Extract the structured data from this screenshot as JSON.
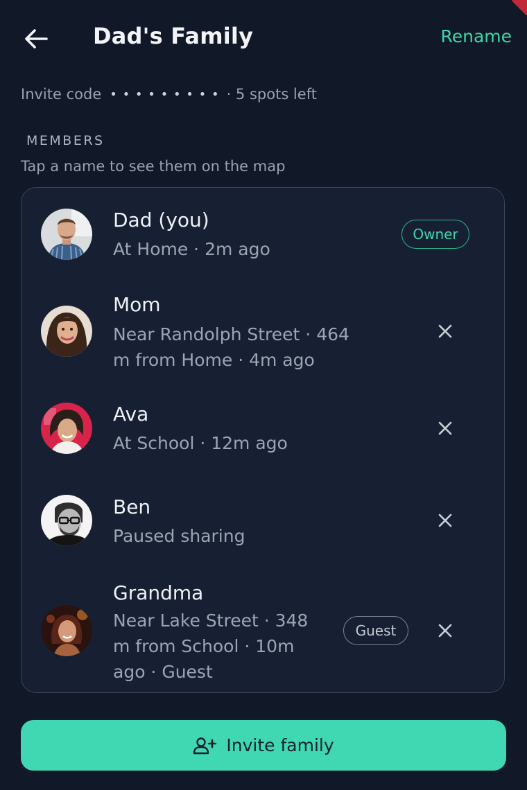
{
  "header": {
    "title": "Dad's Family",
    "rename_label": "Rename",
    "back_icon": "arrow-left-icon"
  },
  "invite": {
    "label": "Invite code",
    "code_masked": "• • • • • • • • •",
    "spots": "· 5 spots left"
  },
  "members_section": {
    "label": "MEMBERS",
    "hint": "Tap a name to see them on the map"
  },
  "members": [
    {
      "name": "Dad (you)",
      "status": "At Home · 2m ago",
      "badge": "Owner",
      "removable": false
    },
    {
      "name": "Mom",
      "status": "Near Randolph Street · 464 m from Home · 4m ago",
      "badge": "",
      "removable": true
    },
    {
      "name": "Ava",
      "status": "At School · 12m ago",
      "badge": "",
      "removable": true
    },
    {
      "name": "Ben",
      "status": "Paused sharing",
      "badge": "",
      "removable": true
    },
    {
      "name": "Grandma",
      "status": "Near Lake Street · 348 m from School · 10m ago · Guest",
      "badge": "Guest",
      "removable": true
    }
  ],
  "actions": {
    "invite_label": "Invite family",
    "invite_icon": "add-person-icon",
    "remove_icon": "close-icon"
  },
  "colors": {
    "background": "#111827",
    "card": "#172032",
    "accent": "#3fd6ab",
    "button": "#3fd8b2"
  }
}
